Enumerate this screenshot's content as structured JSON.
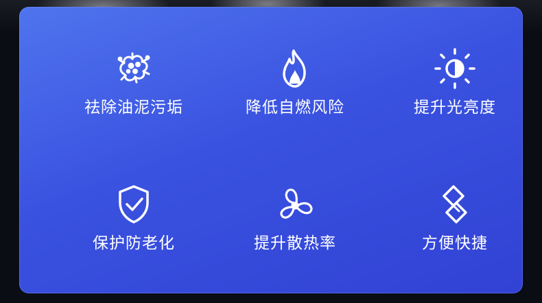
{
  "colors": {
    "card_gradient_start": "#4f74ee",
    "card_gradient_end": "#3142d4",
    "text": "#ffffff"
  },
  "features": [
    {
      "icon": "bacteria-icon",
      "label": "祛除油泥污垢"
    },
    {
      "icon": "flame-icon",
      "label": "降低自燃风险"
    },
    {
      "icon": "sun-brightness-icon",
      "label": "提升光亮度"
    },
    {
      "icon": "shield-check-icon",
      "label": "保护防老化"
    },
    {
      "icon": "fan-icon",
      "label": "提升散热率"
    },
    {
      "icon": "link-icon",
      "label": "方便快捷"
    }
  ]
}
